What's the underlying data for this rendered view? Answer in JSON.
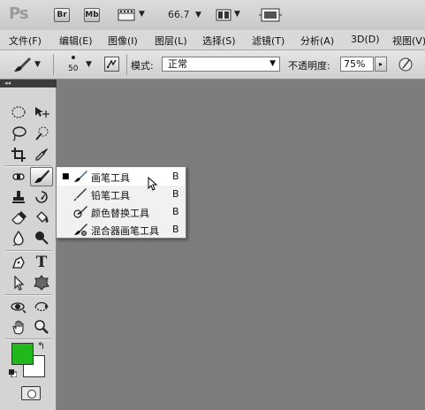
{
  "app": {
    "logo": "Ps",
    "bridge_label": "Br",
    "minibridge_label": "Mb",
    "zoom": "66.7"
  },
  "menu": {
    "items": [
      "文件(F)",
      "编辑(E)",
      "图像(I)",
      "图层(L)",
      "选择(S)",
      "滤镜(T)",
      "分析(A)",
      "3D(D)",
      "视图(V)"
    ]
  },
  "options": {
    "brush_size": "50",
    "mode_label": "模式:",
    "mode_value": "正常",
    "opacity_label": "不透明度:",
    "opacity_value": "75%"
  },
  "toolbox": {
    "collapse_glyph": "◂◂",
    "foreground_color": "#22b71a",
    "background_color": "#ffffff"
  },
  "flyout": {
    "items": [
      {
        "label": "画笔工具",
        "shortcut": "B",
        "icon": "brush-icon",
        "selected": true
      },
      {
        "label": "铅笔工具",
        "shortcut": "B",
        "icon": "pencil-icon",
        "selected": false
      },
      {
        "label": "颜色替换工具",
        "shortcut": "B",
        "icon": "color-replacement-icon",
        "selected": false
      },
      {
        "label": "混合器画笔工具",
        "shortcut": "B",
        "icon": "mixer-brush-icon",
        "selected": false
      }
    ]
  }
}
